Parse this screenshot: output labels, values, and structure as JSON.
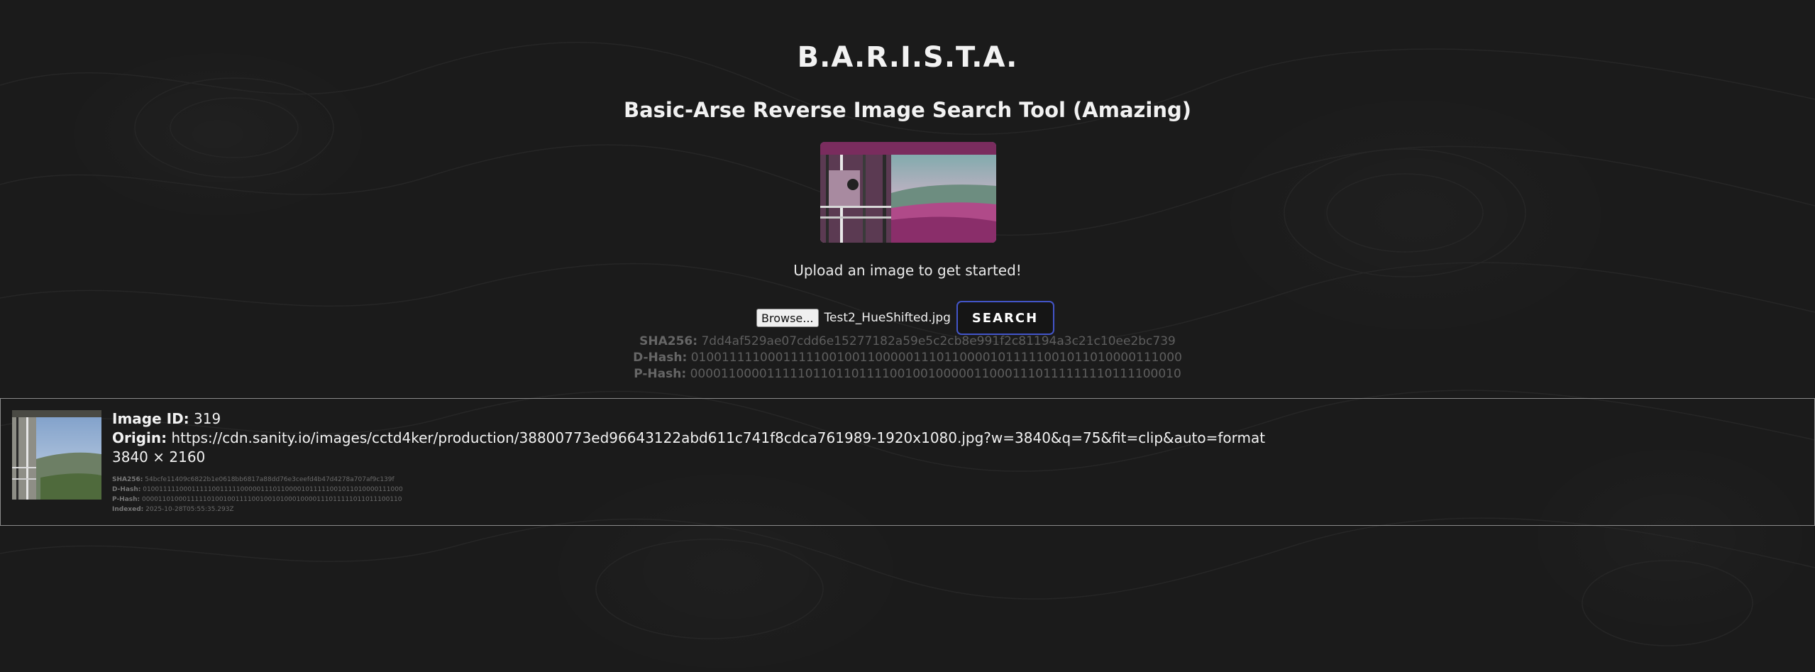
{
  "header": {
    "title": "B.A.R.I.S.T.A.",
    "subtitle": "Basic-Arse Reverse Image Search Tool (Amazing)"
  },
  "upload": {
    "prompt": "Upload an image to get started!",
    "browse_label": "Browse...",
    "file_name": "Test2_HueShifted.jpg",
    "search_label": "SEARCH"
  },
  "query_hashes": {
    "sha256_label": "SHA256:",
    "sha256": "7dd4af529ae07cdd6e15277182a59e5c2cb8e991f2c81194a3c21c10ee2bc739",
    "dhash_label": "D-Hash:",
    "dhash": "0100111110001111100100110000011101100001011111001011010000111000",
    "phash_label": "P-Hash:",
    "phash": "0000110000111110110110111100100100000110001110111111110111100010"
  },
  "result": {
    "id_label": "Image ID:",
    "id": "319",
    "origin_label": "Origin:",
    "origin": "https://cdn.sanity.io/images/cctd4ker/production/38800773ed96643122abd611c741f8cdca761989-1920x1080.jpg?w=3840&q=75&fit=clip&auto=format",
    "dimensions": "3840 × 2160",
    "sha256_label": "SHA256:",
    "sha256": "54bcfe11409c6822b1e0618bb6817a88dd76e3ceefd4b47d4278a707af9c139f",
    "dhash_label": "D-Hash:",
    "dhash": "0100111110001111100111110000011101100001011111001011010000111000",
    "phash_label": "P-Hash:",
    "phash": "0000110100011111010010011110010010100010000111011111011011100110",
    "indexed_label": "Indexed:",
    "indexed": "2025-10-28T05:55:35.293Z"
  },
  "colors": {
    "background": "#1b1b1b",
    "search_border": "#4355c9",
    "card_border": "#8a8a8a"
  }
}
